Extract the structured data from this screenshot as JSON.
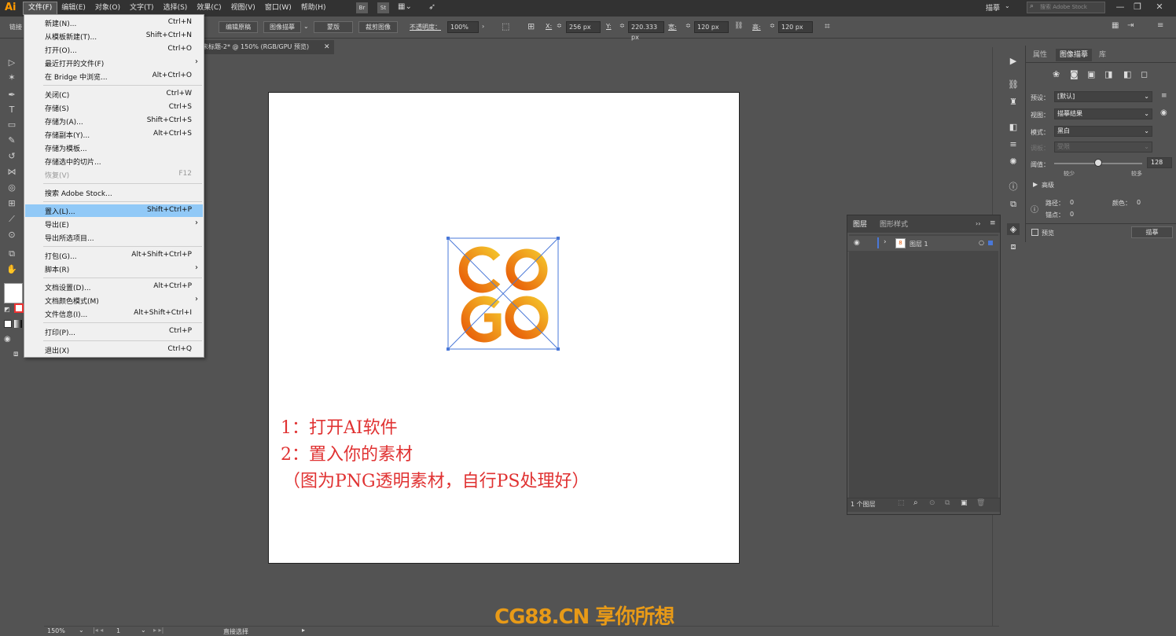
{
  "menubar": {
    "logo": "Ai",
    "items": [
      "文件(F)",
      "编辑(E)",
      "对象(O)",
      "文字(T)",
      "选择(S)",
      "效果(C)",
      "视图(V)",
      "窗口(W)",
      "帮助(H)"
    ],
    "badges": [
      "Br",
      "St"
    ],
    "workspace": "描摹",
    "search_placeholder": "搜索 Adobe Stock",
    "window_buttons": [
      "—",
      "❐",
      "✕"
    ]
  },
  "controlbar": {
    "link_label": "链接",
    "edit_original": "编辑原稿",
    "image_trace": "图像描摹",
    "mask": "蒙版",
    "crop_image": "裁剪图像",
    "opacity_label": "不透明度：",
    "opacity_value": "100%",
    "x_label": "X:",
    "x_value": "256 px",
    "y_label": "Y:",
    "y_value": "220.333 px",
    "w_label": "宽:",
    "w_value": "120 px",
    "h_label": "高:",
    "h_value": "120 px"
  },
  "document_tab": {
    "title": "未标题-2* @ 150% (RGB/GPU 预览)",
    "close": "✕"
  },
  "file_menu": {
    "items": [
      {
        "label": "新建(N)...",
        "shortcut": "Ctrl+N"
      },
      {
        "label": "从模板新建(T)...",
        "shortcut": "Shift+Ctrl+N"
      },
      {
        "label": "打开(O)...",
        "shortcut": "Ctrl+O"
      },
      {
        "label": "最近打开的文件(F)",
        "shortcut": "",
        "submenu": true
      },
      {
        "label": "在 Bridge 中浏览...",
        "shortcut": "Alt+Ctrl+O"
      },
      {
        "label": "关闭(C)",
        "shortcut": "Ctrl+W"
      },
      {
        "label": "存储(S)",
        "shortcut": "Ctrl+S"
      },
      {
        "label": "存储为(A)...",
        "shortcut": "Shift+Ctrl+S"
      },
      {
        "label": "存储副本(Y)...",
        "shortcut": "Alt+Ctrl+S"
      },
      {
        "label": "存储为模板...",
        "shortcut": ""
      },
      {
        "label": "存储选中的切片...",
        "shortcut": ""
      },
      {
        "label": "恢复(V)",
        "shortcut": "F12",
        "disabled": true
      },
      {
        "label": "搜索 Adobe Stock...",
        "shortcut": ""
      },
      {
        "label": "置入(L)...",
        "shortcut": "Shift+Ctrl+P",
        "highlighted": true
      },
      {
        "label": "导出(E)",
        "shortcut": "",
        "submenu": true
      },
      {
        "label": "导出所选项目...",
        "shortcut": ""
      },
      {
        "label": "打包(G)...",
        "shortcut": "Alt+Shift+Ctrl+P"
      },
      {
        "label": "脚本(R)",
        "shortcut": "",
        "submenu": true
      },
      {
        "label": "文档设置(D)...",
        "shortcut": "Alt+Ctrl+P"
      },
      {
        "label": "文档颜色模式(M)",
        "shortcut": "",
        "submenu": true
      },
      {
        "label": "文件信息(I)...",
        "shortcut": "Alt+Shift+Ctrl+I"
      },
      {
        "label": "打印(P)...",
        "shortcut": "Ctrl+P"
      },
      {
        "label": "退出(X)",
        "shortcut": "Ctrl+Q"
      }
    ]
  },
  "canvas_notes": {
    "line1": "1：打开AI软件",
    "line2": "2：置入你的素材",
    "line3": "（图为PNG透明素材，自行PS处理好）"
  },
  "image_trace_panel": {
    "tabs": [
      "属性",
      "图像描摹",
      "库"
    ],
    "preset_label": "预设：",
    "preset_value": "[默认]",
    "view_label": "视图：",
    "view_value": "描摹结果",
    "mode_label": "模式：",
    "mode_value": "黑白",
    "palette_label": "调板：",
    "palette_value": "受限",
    "threshold_label": "阈值：",
    "threshold_value": "128",
    "threshold_fraction": 0.5,
    "less": "较少",
    "more": "较多",
    "advanced": "高级",
    "paths_label": "路径：",
    "paths_value": "0",
    "colors_label": "颜色：",
    "colors_value": "0",
    "anchors_label": "锚点：",
    "anchors_value": "0",
    "preview_label": "预览",
    "trace_button": "描摹"
  },
  "layers_panel": {
    "tabs": [
      "图层",
      "图形样式"
    ],
    "layer_name": "图层 1",
    "count": "1 个图层"
  },
  "statusbar": {
    "zoom": "150%",
    "page": "1",
    "tool": "直接选择"
  },
  "watermark": "CG88.CN 享你所想",
  "colors": {
    "accent_orange": "#ff9a00",
    "note_red": "#e03232",
    "menu_highlight": "#91c9f7",
    "selection_blue": "#4a78d8"
  }
}
